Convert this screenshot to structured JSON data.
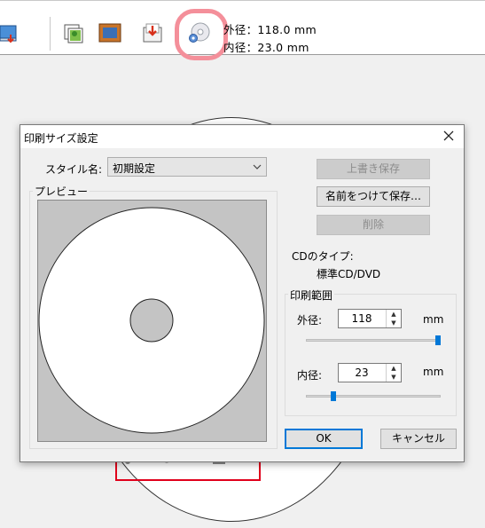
{
  "toolbar": {
    "outer_diameter_label": "外径：",
    "outer_diameter_value": "118.0 mm",
    "inner_diameter_label": "内径：",
    "inner_diameter_value": "23.0 mm"
  },
  "dialog": {
    "title": "印刷サイズ設定",
    "style_name_label": "スタイル名:",
    "style_selected": "初期設定",
    "preview_label": "プレビュー",
    "overwrite_save": "上書き保存",
    "save_as": "名前をつけて保存…",
    "delete": "削除",
    "cd_type_label": "CDのタイプ:",
    "cd_type_value": "標準CD/DVD",
    "print_range_label": "印刷範囲",
    "outer_label": "外径:",
    "outer_value": "118",
    "outer_unit": "mm",
    "outer_slider": 1.0,
    "inner_label": "内径:",
    "inner_value": "23",
    "inner_unit": "mm",
    "inner_slider": 0.19,
    "ok": "OK",
    "cancel": "キャンセル"
  },
  "colors": {
    "highlight": "#f48f9a",
    "accent": "#0078d7",
    "print_frame": "#e0001b"
  }
}
